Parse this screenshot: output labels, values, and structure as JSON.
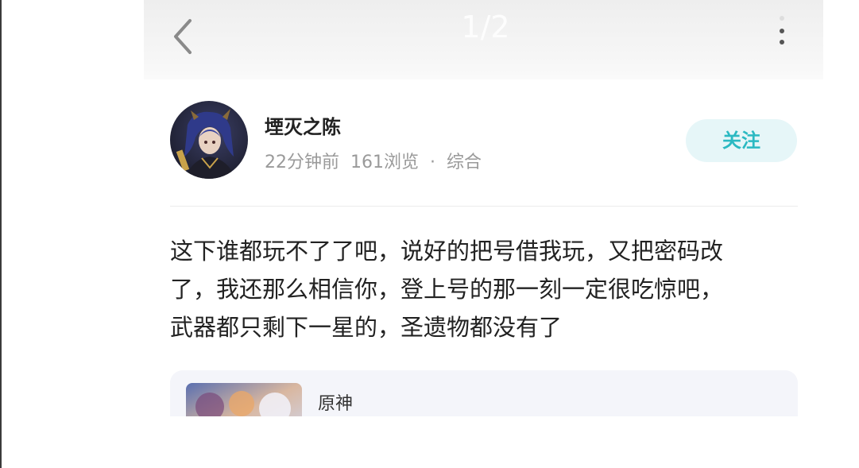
{
  "header": {
    "page_counter": "1/2",
    "back_icon": "chevron-left-icon",
    "more_icon": "more-vertical-icon"
  },
  "author": {
    "name": "堙灭之陈",
    "time": "22分钟前",
    "views": "161浏览",
    "separator": "·",
    "category": "综合",
    "follow_label": "关注"
  },
  "post": {
    "lines": [
      "这下谁都玩不了了吧，说好的把号借我玩，又把密码改",
      "了，我还那么相信你，登上号的那一刻一定很吃惊吧，",
      "武器都只剩下一星的，圣遗物都没有了"
    ]
  },
  "game_card": {
    "name": "原神"
  },
  "colors": {
    "accent": "#2bb9c2",
    "follow_bg": "#e6f6f8",
    "meta_text": "#9a9a9a",
    "card_bg": "#f4f5fa"
  }
}
